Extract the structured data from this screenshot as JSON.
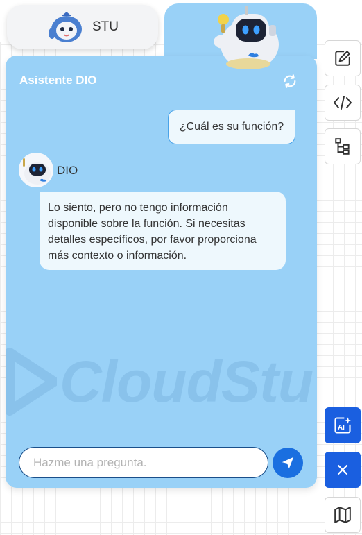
{
  "tabs": {
    "stu_label": "STU"
  },
  "panel": {
    "title": "Asistente DIO"
  },
  "messages": {
    "user_text": "¿Cuál es su función?",
    "bot_name": "DIO",
    "bot_text": "Lo siento, pero no tengo información disponible sobre la función. Si necesitas detalles específicos, por favor proporciona más contexto o información."
  },
  "watermark": {
    "text": "CloudStu"
  },
  "input": {
    "placeholder": "Hazme una pregunta."
  },
  "sidebar": {
    "buttons": [
      {
        "icon": "edit-icon"
      },
      {
        "icon": "code-icon"
      },
      {
        "icon": "tree-icon"
      },
      {
        "icon": "ai-image-icon"
      },
      {
        "icon": "close-icon"
      },
      {
        "icon": "map-icon"
      }
    ]
  },
  "colors": {
    "panel": "#99d1f7",
    "accent": "#1a6fe0",
    "bubble": "#eef8fd"
  }
}
